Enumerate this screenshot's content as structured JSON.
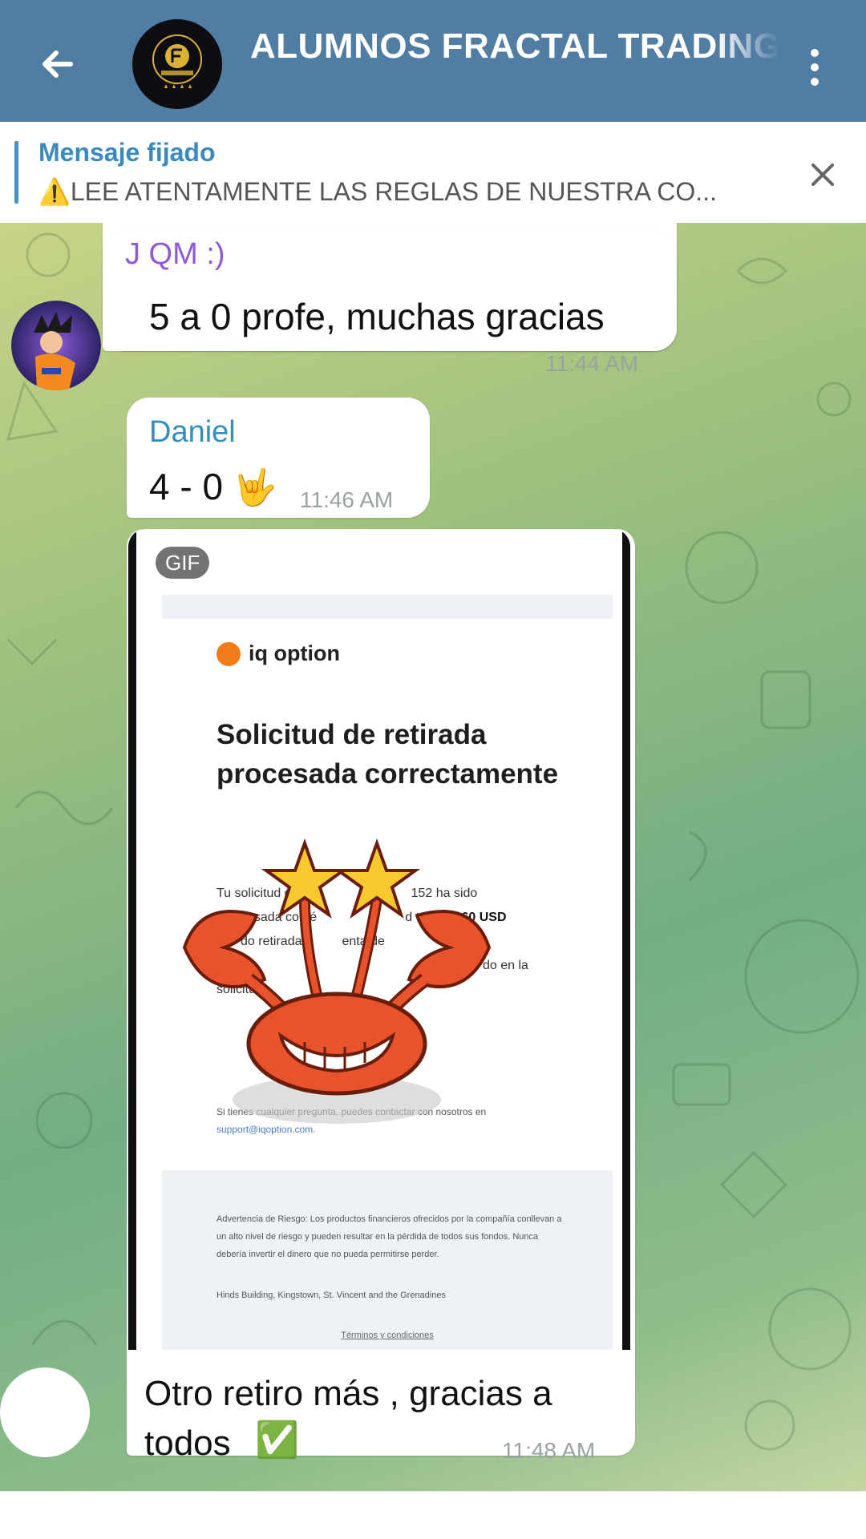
{
  "header": {
    "title": "ALUMNOS FRACTAL TRADING",
    "back_icon": "arrow-left-icon",
    "menu_icon": "more-vertical-icon",
    "avatar_icon": "fractal-logo",
    "accent_color": "#517da2"
  },
  "pinned": {
    "title": "Mensaje fijado",
    "warning_icon": "⚠️",
    "text": "LEE ATENTAMENTE LAS REGLAS DE NUESTRA CO...",
    "close_icon": "close-icon"
  },
  "messages": [
    {
      "sender": "J QM :)",
      "sender_color": "#8e5bd6",
      "text": "5 a 0 profe, muchas gracias",
      "time": "11:44 AM"
    },
    {
      "sender": "Daniel",
      "sender_color": "#2f8fbe",
      "text": "4 - 0",
      "emoji": "🤟",
      "time": "11:46 AM"
    },
    {
      "type": "gif",
      "badge": "GIF",
      "email": {
        "brand": "iq option",
        "title": "Solicitud de retirada procesada correctamente",
        "body_line1_a": "Tu solicitud de",
        "body_line1_b": "152  ha sido",
        "body_line2_a": "cesada con é",
        "body_line2_b": "d total de",
        "body_amount": "60 USD",
        "body_line3_a": "do retirada",
        "body_line3_b": "enta de",
        "body_line3_c": "Tus",
        "body_line4": "do en la",
        "body_line5": "solicitu",
        "contact": "Si tienes cualquier pregunta, puedes contactar con nosotros en",
        "contact_link": "support@iqoption.com.",
        "risk": "Advertencia de Riesgo: Los productos financieros ofrecidos por la compañía conllevan a un alto nivel de riesgo y pueden resultar en la pérdida de todos sus fondos. Nunca debería invertir el dinero que no pueda permitirse perder.",
        "address": "Hinds Building, Kingstown, St. Vincent and the Grenadines",
        "terms": "Términos y condiciones"
      },
      "caption": "Otro retiro más , gracias a todos",
      "caption_emoji": "✅",
      "time": "11:48 AM"
    }
  ]
}
